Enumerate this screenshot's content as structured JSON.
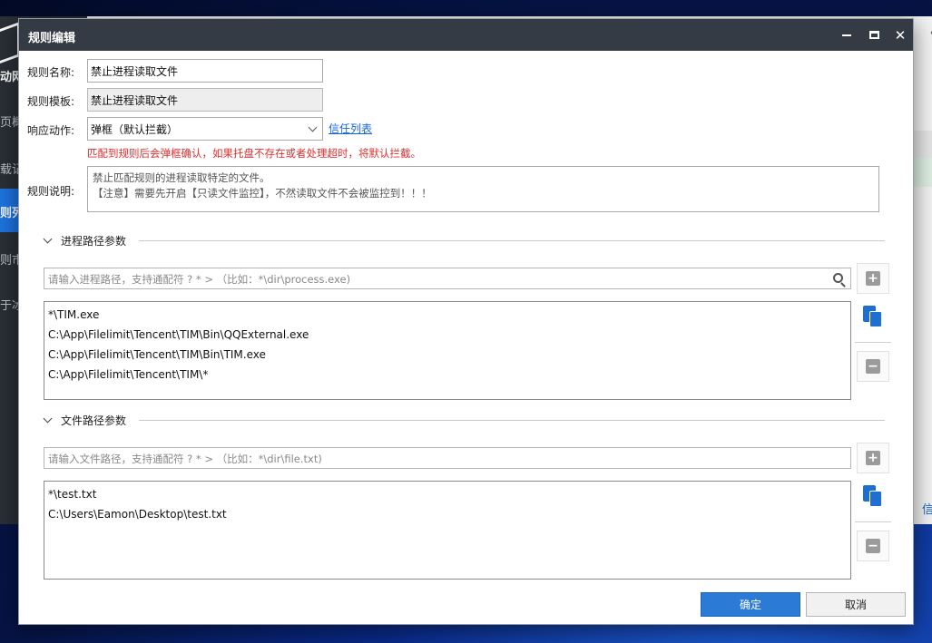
{
  "background_app": {
    "sidebar_fragments": [
      "动网",
      "页概",
      "载记",
      "则列",
      "则市",
      "于冰"
    ],
    "right_link_fragment": "信",
    "right_top_fragment": "〈"
  },
  "dialog": {
    "title": "规则编辑",
    "window_controls": {
      "minimize": "minimize-icon",
      "maximize": "maximize-icon",
      "close": "close-icon"
    },
    "rule_name": {
      "label": "规则名称:",
      "value": "禁止进程读取文件"
    },
    "rule_template": {
      "label": "规则模板:",
      "value": "禁止进程读取文件"
    },
    "response_action": {
      "label": "响应动作:",
      "value": "弹框（默认拦截）",
      "trust_link": "信任列表"
    },
    "warning": "匹配到规则后会弹框确认，如果托盘不存在或者处理超时，将默认拦截。",
    "rule_desc": {
      "label": "规则说明:",
      "text": "禁止匹配规则的进程读取特定的文件。\n【注意】需要先开启【只读文件监控】，不然读取文件不会被监控到！！！"
    },
    "process_section": {
      "title": "进程路径参数",
      "placeholder": "请输入进程路径，支持通配符 ? * >  （比如：*\\dir\\process.exe)",
      "items": [
        "*\\TIM.exe",
        "C:\\App\\Filelimit\\Tencent\\TIM\\Bin\\QQExternal.exe",
        "C:\\App\\Filelimit\\Tencent\\TIM\\Bin\\TIM.exe",
        "C:\\App\\Filelimit\\Tencent\\TIM\\*"
      ]
    },
    "file_section": {
      "title": "文件路径参数",
      "placeholder": "请输入文件路径，支持通配符 ? * >  （比如：*\\dir\\file.txt)",
      "items": [
        "*\\test.txt",
        "C:\\Users\\Eamon\\Desktop\\test.txt"
      ]
    },
    "buttons": {
      "ok": "确定",
      "cancel": "取消"
    },
    "icons": {
      "add": "+",
      "remove": "−"
    },
    "colors": {
      "titlebar": "#353b44",
      "primary": "#2a7ad6",
      "warning": "#e03030",
      "link": "#1565d8"
    }
  }
}
